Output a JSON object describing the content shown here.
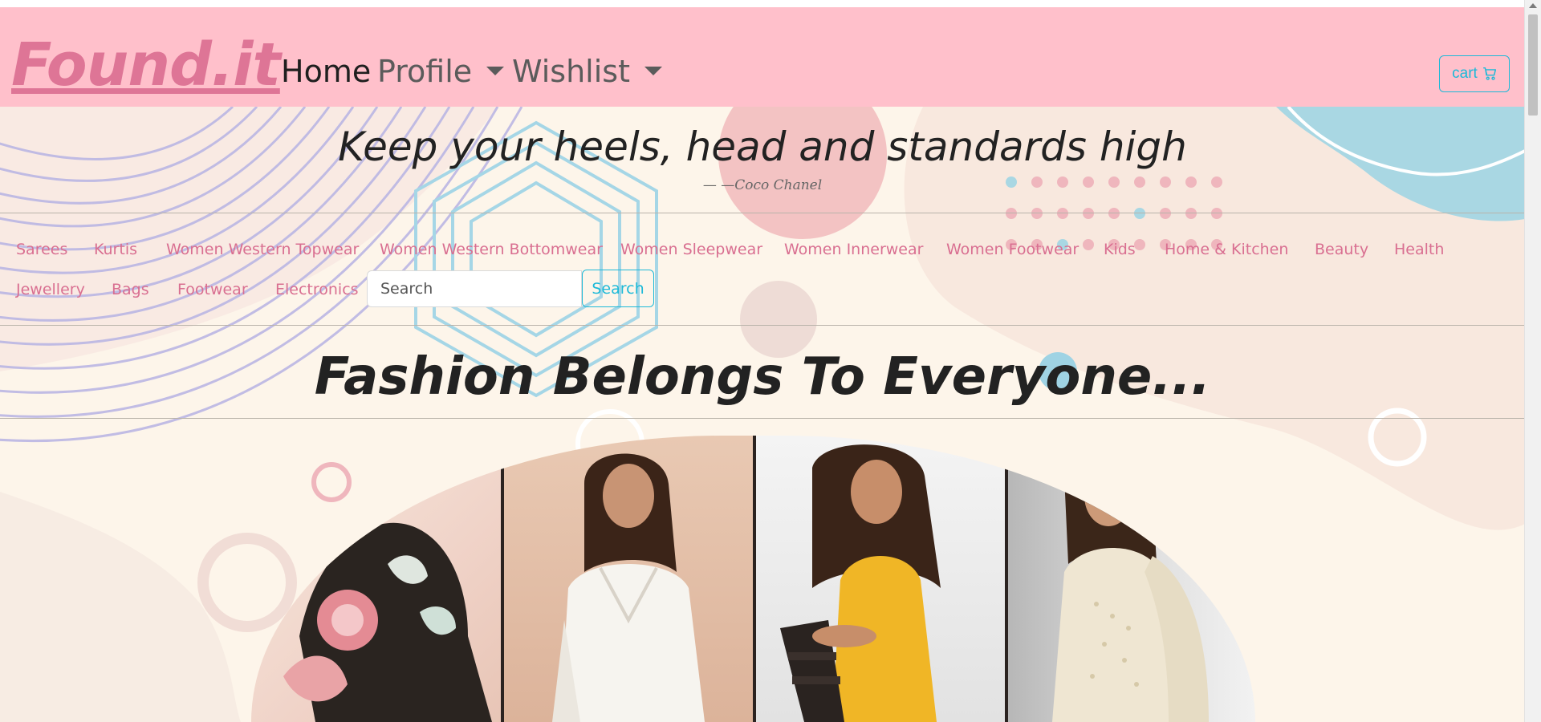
{
  "brand": "Found.it",
  "nav": {
    "home": "Home",
    "profile": "Profile",
    "wishlist": "Wishlist",
    "cart": "cart"
  },
  "quote": {
    "text": "Keep your heels, head and standards high",
    "author": "— —Coco Chanel"
  },
  "categories": [
    "Sarees",
    "Kurtis",
    "Women Western Topwear",
    "Women Western Bottomwear",
    "Women Sleepwear",
    "Women Innerwear",
    "Women Footwear",
    "Kids",
    "Home & Kitchen",
    "Beauty",
    "Health",
    "Jewellery",
    "Bags",
    "Footwear",
    "Electronics"
  ],
  "search": {
    "placeholder": "Search",
    "button": "Search"
  },
  "headline": "Fashion Belongs To Everyone...",
  "colors": {
    "navbar": "#ffc0cb",
    "brand": "#de7596",
    "accent": "#1cb9d8",
    "category": "#d96f91",
    "background": "#fdf5ea"
  },
  "icons": [
    "cart-icon",
    "chevron-down-icon"
  ]
}
